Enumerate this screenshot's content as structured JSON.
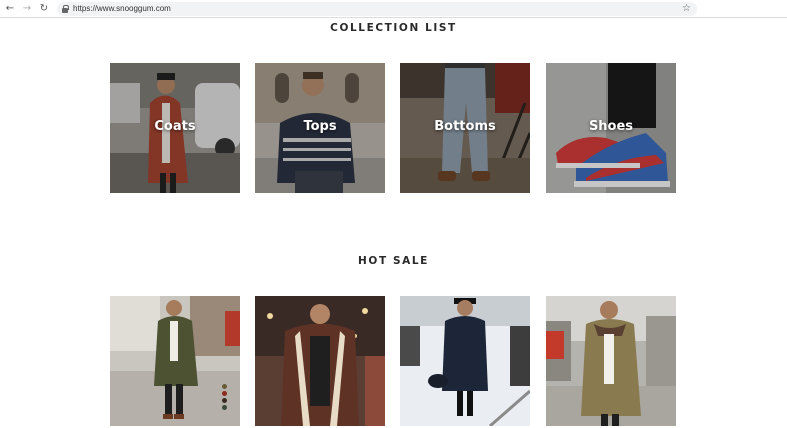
{
  "browser": {
    "url": "https://www.snooggum.com",
    "back_icon": "arrow-left-icon",
    "forward_icon": "arrow-right-icon",
    "reload_icon": "reload-icon",
    "bookmark_icon": "star-icon"
  },
  "collection": {
    "title": "COLLECTION LIST",
    "items": [
      {
        "label": "Coats"
      },
      {
        "label": "Tops"
      },
      {
        "label": "Bottoms"
      },
      {
        "label": "Shoes"
      }
    ]
  },
  "hot_sale": {
    "title": "HOT SALE",
    "products": [
      {
        "image": "man in olive green coat on street",
        "swatches": [
          "#6b5a3a",
          "#8a2a1c",
          "#3b2a22",
          "#3a4a3a"
        ]
      },
      {
        "image": "man in brown shearling coat"
      },
      {
        "image": "man in navy coat in snow"
      },
      {
        "image": "man in khaki coat with fur collar"
      }
    ]
  }
}
